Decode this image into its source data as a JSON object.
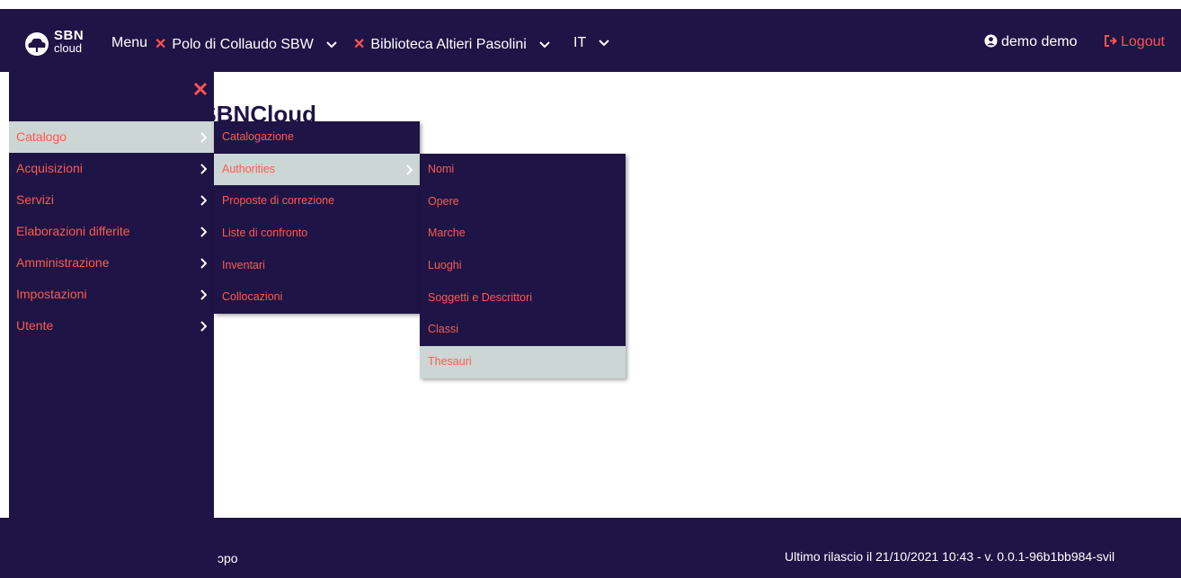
{
  "topbar": {
    "logo_line1": "SBN",
    "logo_line2": "cloud",
    "menu_label": "Menu",
    "polo_label": "Polo di Collaudo SBW",
    "biblioteca_label": "Biblioteca Altieri Pasolini",
    "language": "IT",
    "user_name": "demo demo",
    "logout_label": "Logout"
  },
  "page": {
    "title_fragment": "o in SBNCloud"
  },
  "sidemenu": {
    "items": [
      {
        "label": "Catalogo"
      },
      {
        "label": "Acquisizioni"
      },
      {
        "label": "Servizi"
      },
      {
        "label": "Elaborazioni differite"
      },
      {
        "label": "Amministrazione"
      },
      {
        "label": "Impostazioni"
      },
      {
        "label": "Utente"
      }
    ]
  },
  "catalogo_submenu": {
    "items": [
      {
        "label": "Catalogazione"
      },
      {
        "label": "Authorities"
      },
      {
        "label": "Proposte di correzione"
      },
      {
        "label": "Liste di confronto"
      },
      {
        "label": "Inventari"
      },
      {
        "label": "Collocazioni"
      }
    ]
  },
  "authorities_submenu": {
    "items": [
      {
        "label": "Nomi"
      },
      {
        "label": "Opere"
      },
      {
        "label": "Marche"
      },
      {
        "label": "Luoghi"
      },
      {
        "label": "Soggetti e Descrittori"
      },
      {
        "label": "Classi"
      },
      {
        "label": "Thesauri"
      }
    ]
  },
  "footer": {
    "left_fragment": "ɔpo",
    "release_info": "Ultimo rilascio il 21/10/2021 10:43 - v. 0.0.1-96b1bb984-svil"
  },
  "colors": {
    "navy": "#1e1445",
    "accent": "#ff5252",
    "menu_text": "#ff5a4d",
    "highlight": "#ccd6d4"
  }
}
